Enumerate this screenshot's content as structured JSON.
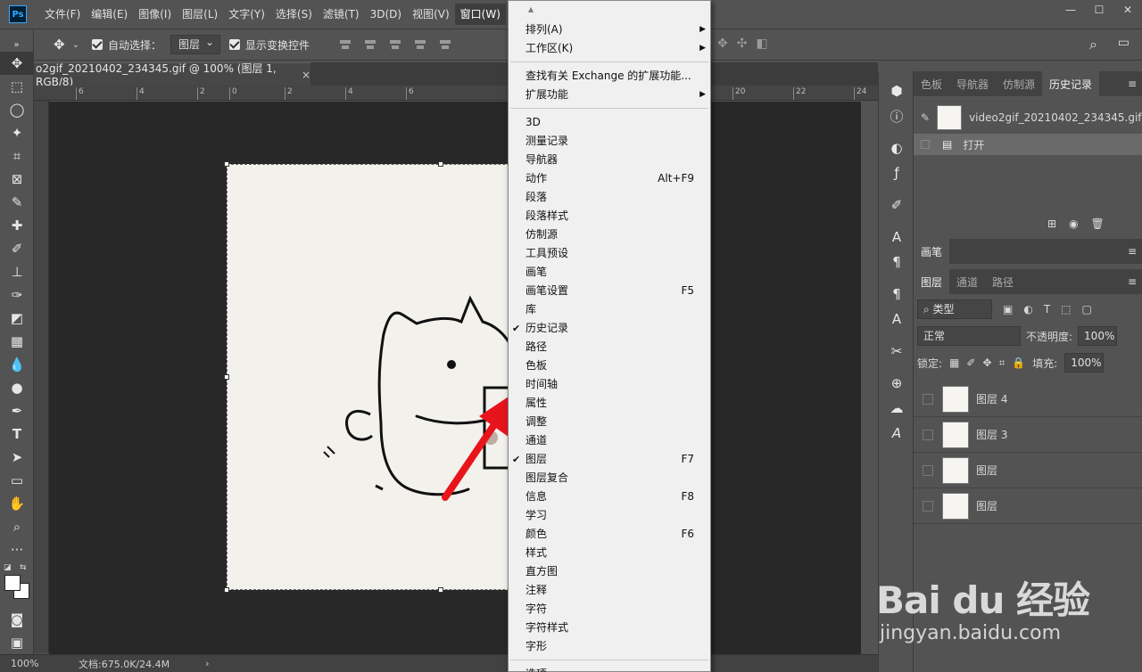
{
  "app": {
    "logo": "Ps"
  },
  "menubar": {
    "items": [
      "文件(F)",
      "编辑(E)",
      "图像(I)",
      "图层(L)",
      "文字(Y)",
      "选择(S)",
      "滤镜(T)",
      "3D(D)",
      "视图(V)",
      "窗口(W)"
    ],
    "active": "窗口(W)"
  },
  "window_controls": {
    "minimize": "—",
    "maximize": "☐",
    "close": "✕"
  },
  "options": {
    "auto_select_label": "自动选择：",
    "auto_select_value": "图层",
    "show_transform_label": "显示变换控件"
  },
  "document": {
    "tab_title": "o2gif_20210402_234345.gif @ 100% (图层 1, RGB/8)",
    "close": "×",
    "status": "文档:675.0K/24.4M",
    "zoom": "100%"
  },
  "ruler": {
    "ticks": [
      "6",
      "4",
      "2",
      "0",
      "2",
      "4",
      "6",
      "20",
      "22",
      "24"
    ]
  },
  "panels": {
    "top_tabs": [
      "色板",
      "导航器",
      "仿制源",
      "历史记录"
    ],
    "top_active": "历史记录",
    "history_snapshot": "video2gif_20210402_234345.gif",
    "history_step": "打开",
    "brush_tab": "画笔",
    "layer_tabs": [
      "图层",
      "通道",
      "路径"
    ],
    "layer_active": "图层",
    "filter_label": "类型",
    "blend_mode": "正常",
    "opacity_label": "不透明度:",
    "opacity_value": "100%",
    "lock_label": "锁定:",
    "fill_label": "填充:",
    "fill_value": "100%",
    "layers": [
      "图层 4",
      "图层 3",
      "图层",
      "图层"
    ]
  },
  "window_menu": {
    "items": [
      {
        "label": "排列(A)",
        "submenu": true
      },
      {
        "label": "工作区(K)",
        "submenu": true
      },
      {
        "sep": true
      },
      {
        "label": "查找有关 Exchange 的扩展功能..."
      },
      {
        "label": "扩展功能",
        "submenu": true
      },
      {
        "sep": true
      },
      {
        "label": "3D"
      },
      {
        "label": "测量记录"
      },
      {
        "label": "导航器"
      },
      {
        "label": "动作",
        "shortcut": "Alt+F9"
      },
      {
        "label": "段落"
      },
      {
        "label": "段落样式"
      },
      {
        "label": "仿制源"
      },
      {
        "label": "工具预设"
      },
      {
        "label": "画笔"
      },
      {
        "label": "画笔设置",
        "shortcut": "F5"
      },
      {
        "label": "库"
      },
      {
        "label": "历史记录",
        "checked": true
      },
      {
        "label": "路径"
      },
      {
        "label": "色板"
      },
      {
        "label": "时间轴"
      },
      {
        "label": "属性"
      },
      {
        "label": "调整"
      },
      {
        "label": "通道"
      },
      {
        "label": "图层",
        "checked": true,
        "shortcut": "F7"
      },
      {
        "label": "图层复合"
      },
      {
        "label": "信息",
        "shortcut": "F8"
      },
      {
        "label": "学习"
      },
      {
        "label": "颜色",
        "shortcut": "F6"
      },
      {
        "label": "样式"
      },
      {
        "label": "直方图"
      },
      {
        "label": "注释"
      },
      {
        "label": "字符"
      },
      {
        "label": "字符样式"
      },
      {
        "label": "字形"
      },
      {
        "sep": true
      },
      {
        "label": "选项"
      }
    ]
  },
  "watermark": {
    "main": "Bai du 经验",
    "sub": "jingyan.baidu.com"
  },
  "colors": {
    "accent": "#31a8ff",
    "annotation_arrow": "#e8141c",
    "menu_bg": "#f0f0f0",
    "canvas_bg": "#282828"
  }
}
